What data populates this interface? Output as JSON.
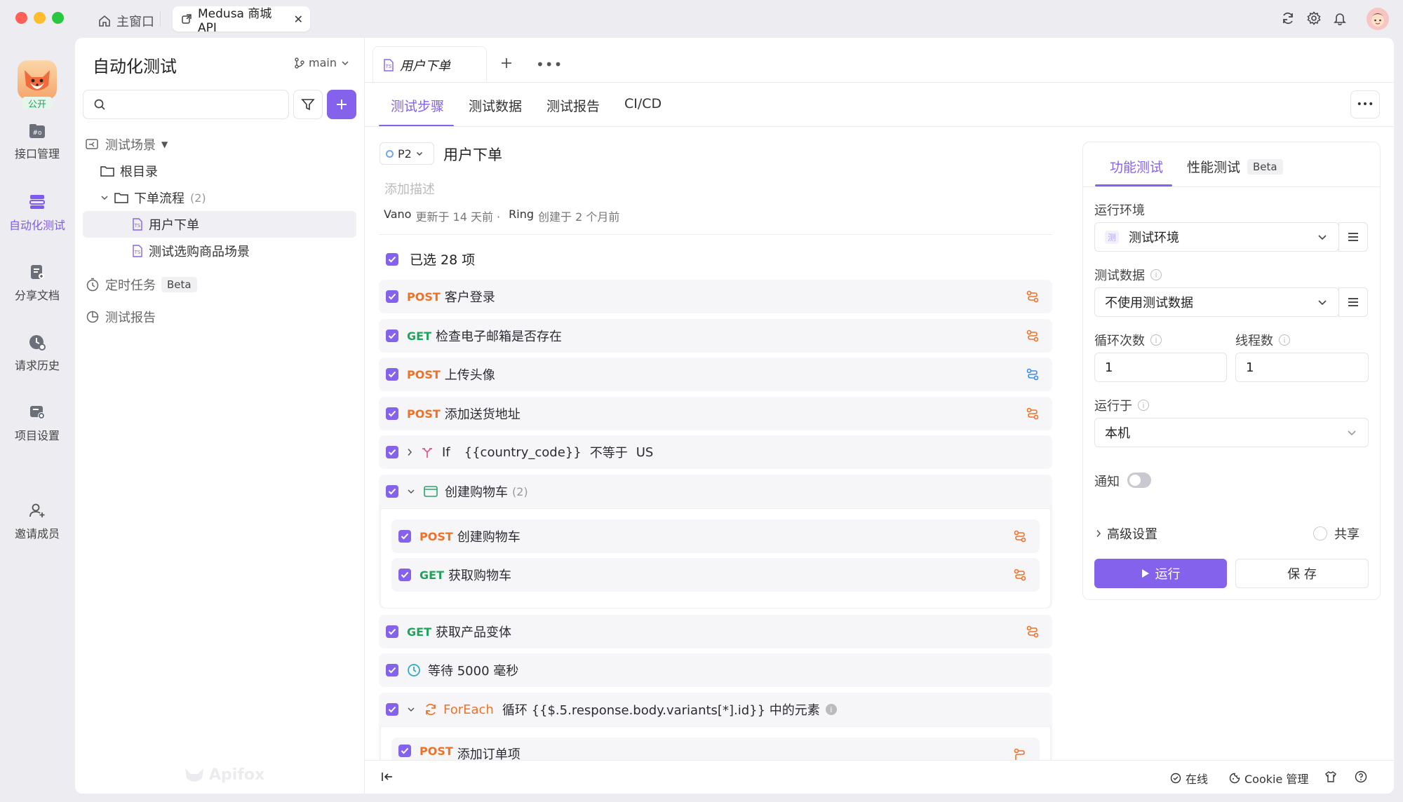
{
  "window": {
    "home_tab": "主窗口",
    "active_tab": "Medusa 商城 API"
  },
  "rail": {
    "badge": "公开",
    "items": [
      "接口管理",
      "自动化测试",
      "分享文档",
      "请求历史",
      "项目设置",
      "邀请成员"
    ]
  },
  "sidebar": {
    "title": "自动化测试",
    "branch": "main",
    "tree": {
      "scenes": "测试场景",
      "root": "根目录",
      "folder": "下单流程",
      "folder_count": "(2)",
      "item1": "用户下单",
      "item2": "测试选购商品场景",
      "scheduled": "定时任务",
      "scheduled_badge": "Beta",
      "reports": "测试报告"
    },
    "watermark": "Apifox"
  },
  "editor": {
    "doc_tab": "用户下单",
    "subtabs": [
      "测试步骤",
      "测试数据",
      "测试报告",
      "CI/CD"
    ],
    "priority": "P2",
    "title": "用户下单",
    "desc_placeholder": "添加描述",
    "meta_user1": "Vano",
    "meta_text1": "更新于 14 天前 ·",
    "meta_user2": "Ring",
    "meta_text2": "创建于 2 个月前",
    "selected": "已选 28 项"
  },
  "steps": [
    {
      "method": "POST",
      "name": "客户登录"
    },
    {
      "method": "GET",
      "name": "检查电子邮箱是否存在"
    },
    {
      "method": "POST",
      "name": "上传头像"
    },
    {
      "method": "POST",
      "name": "添加送货地址"
    },
    {
      "kw": "If",
      "expr": "{{country_code}}",
      "op": "不等于",
      "val": "US"
    },
    {
      "group": "创建购物车",
      "count": "(2)"
    },
    {
      "method": "POST",
      "name": "创建购物车"
    },
    {
      "method": "GET",
      "name": "获取购物车"
    },
    {
      "method": "GET",
      "name": "获取产品变体"
    },
    {
      "wait": "等待 5000 毫秒"
    },
    {
      "kw": "ForEach",
      "text": "循环 {{$.5.response.body.variants[*].id}} 中的元素"
    },
    {
      "method": "POST",
      "name": "添加订单项"
    }
  ],
  "config": {
    "tabs": [
      "功能测试",
      "性能测试"
    ],
    "beta": "Beta",
    "env_label": "运行环境",
    "env_tag": "测",
    "env_value": "测试环境",
    "data_label": "测试数据",
    "data_value": "不使用测试数据",
    "loop_label": "循环次数",
    "loop_value": "1",
    "threads_label": "线程数",
    "threads_value": "1",
    "runon_label": "运行于",
    "runon_value": "本机",
    "notify_label": "通知",
    "advanced": "高级设置",
    "share": "共享",
    "run": "运行",
    "save": "保 存"
  },
  "statusbar": {
    "online": "在线",
    "cookie": "Cookie 管理"
  },
  "colors": {
    "accent": "#8562eb",
    "post": "#f07126",
    "get": "#1fa45c"
  }
}
